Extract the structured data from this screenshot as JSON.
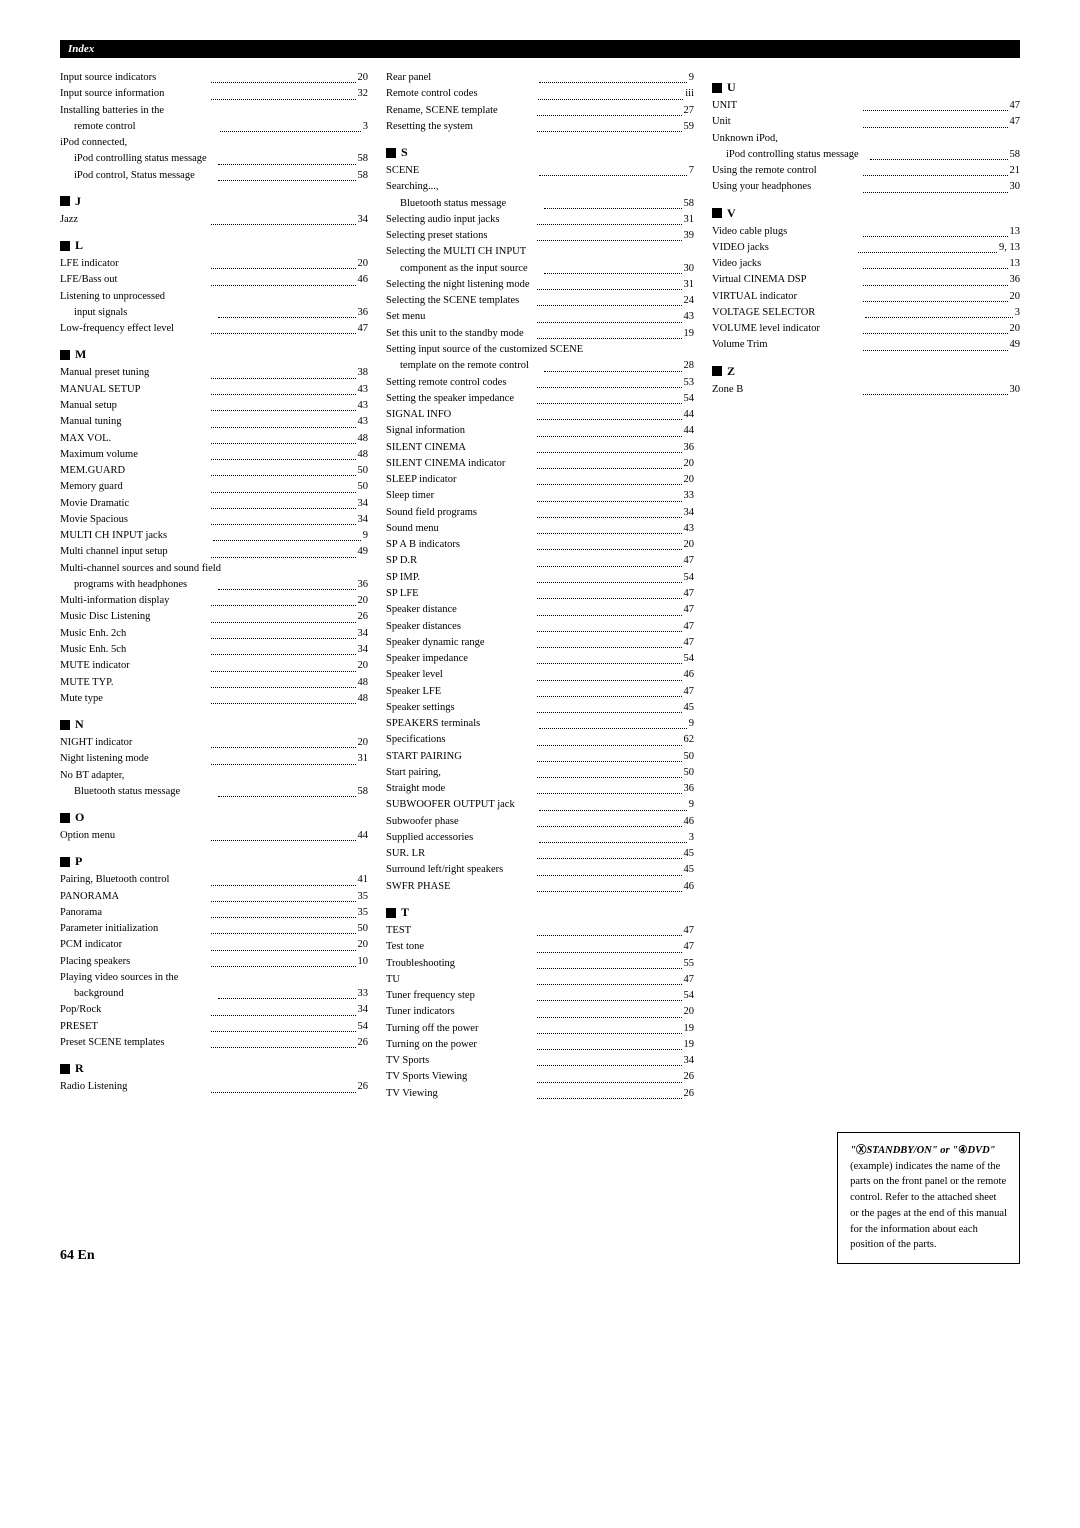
{
  "header": {
    "label": "Index"
  },
  "pageNumber": "64 En",
  "columns": [
    {
      "id": "col1",
      "sections": [
        {
          "type": "entries",
          "items": [
            {
              "text": "Input source indicators",
              "page": "20"
            },
            {
              "text": "Input source information",
              "page": "32"
            },
            {
              "text": "Installing batteries in the",
              "page": ""
            },
            {
              "text": "remote control",
              "page": "3",
              "indent": 1
            },
            {
              "text": "iPod connected,",
              "page": ""
            },
            {
              "text": "iPod controlling status message",
              "page": "58",
              "indent": 1
            },
            {
              "text": "iPod control, Status message",
              "page": "58",
              "indent": 1
            }
          ]
        },
        {
          "type": "section",
          "letter": "J",
          "items": [
            {
              "text": "Jazz",
              "page": "34"
            }
          ]
        },
        {
          "type": "section",
          "letter": "L",
          "items": [
            {
              "text": "LFE indicator",
              "page": "20"
            },
            {
              "text": "LFE/Bass out",
              "page": "46"
            },
            {
              "text": "Listening to unprocessed",
              "page": ""
            },
            {
              "text": "input signals",
              "page": "36",
              "indent": 1
            },
            {
              "text": "Low-frequency effect level",
              "page": "47"
            }
          ]
        },
        {
          "type": "section",
          "letter": "M",
          "items": [
            {
              "text": "Manual preset tuning",
              "page": "38"
            },
            {
              "text": "MANUAL SETUP",
              "page": "43"
            },
            {
              "text": "Manual setup",
              "page": "43"
            },
            {
              "text": "Manual tuning",
              "page": "43"
            },
            {
              "text": "MAX VOL.",
              "page": "48"
            },
            {
              "text": "Maximum volume",
              "page": "48"
            },
            {
              "text": "MEM.GUARD",
              "page": "50"
            },
            {
              "text": "Memory guard",
              "page": "50"
            },
            {
              "text": "Movie Dramatic",
              "page": "34"
            },
            {
              "text": "Movie Spacious",
              "page": "34"
            },
            {
              "text": "MULTI CH INPUT jacks",
              "page": "9"
            },
            {
              "text": "Multi channel input setup",
              "page": "49"
            },
            {
              "text": "Multi-channel sources and sound field",
              "page": ""
            },
            {
              "text": "programs with headphones",
              "page": "36",
              "indent": 1
            },
            {
              "text": "Multi-information display",
              "page": "20"
            },
            {
              "text": "Music Disc Listening",
              "page": "26"
            },
            {
              "text": "Music Enh. 2ch",
              "page": "34"
            },
            {
              "text": "Music Enh. 5ch",
              "page": "34"
            },
            {
              "text": "MUTE indicator",
              "page": "20"
            },
            {
              "text": "MUTE TYP.",
              "page": "48"
            },
            {
              "text": "Mute type",
              "page": "48"
            }
          ]
        },
        {
          "type": "section",
          "letter": "N",
          "items": [
            {
              "text": "NIGHT indicator",
              "page": "20"
            },
            {
              "text": "Night listening mode",
              "page": "31"
            },
            {
              "text": "No BT adapter,",
              "page": ""
            },
            {
              "text": "Bluetooth status message",
              "page": "58",
              "indent": 1
            }
          ]
        },
        {
          "type": "section",
          "letter": "O",
          "items": [
            {
              "text": "Option menu",
              "page": "44"
            }
          ]
        },
        {
          "type": "section",
          "letter": "P",
          "items": [
            {
              "text": "Pairing, Bluetooth control",
              "page": "41"
            },
            {
              "text": "PANORAMA",
              "page": "35"
            },
            {
              "text": "Panorama",
              "page": "35"
            },
            {
              "text": "Parameter initialization",
              "page": "50"
            },
            {
              "text": "PCM indicator",
              "page": "20"
            },
            {
              "text": "Placing speakers",
              "page": "10"
            },
            {
              "text": "Playing video sources in the",
              "page": ""
            },
            {
              "text": "background",
              "page": "33",
              "indent": 1
            },
            {
              "text": "Pop/Rock",
              "page": "34"
            },
            {
              "text": "PRESET",
              "page": "54"
            },
            {
              "text": "Preset SCENE templates",
              "page": "26"
            }
          ]
        },
        {
          "type": "section",
          "letter": "R",
          "items": [
            {
              "text": "Radio Listening",
              "page": "26"
            }
          ]
        }
      ]
    },
    {
      "id": "col2",
      "sections": [
        {
          "type": "entries",
          "items": [
            {
              "text": "Rear panel",
              "page": "9"
            },
            {
              "text": "Remote control codes",
              "page": "iii"
            },
            {
              "text": "Rename, SCENE template",
              "page": "27"
            },
            {
              "text": "Resetting the system",
              "page": "59"
            }
          ]
        },
        {
          "type": "section",
          "letter": "S",
          "items": [
            {
              "text": "SCENE",
              "page": "7"
            },
            {
              "text": "Searching...,",
              "page": ""
            },
            {
              "text": "Bluetooth status message",
              "page": "58",
              "indent": 1
            },
            {
              "text": "Selecting audio input jacks",
              "page": "31"
            },
            {
              "text": "Selecting preset stations",
              "page": "39"
            },
            {
              "text": "Selecting the MULTI CH INPUT",
              "page": ""
            },
            {
              "text": "component as the input source",
              "page": "30",
              "indent": 1
            },
            {
              "text": "Selecting the night listening mode",
              "page": "31"
            },
            {
              "text": "Selecting the SCENE templates",
              "page": "24"
            },
            {
              "text": "Set menu",
              "page": "43"
            },
            {
              "text": "Set this unit to the standby mode",
              "page": "19"
            },
            {
              "text": "Setting input source of the customized SCENE",
              "page": ""
            },
            {
              "text": "template on the remote control",
              "page": "28",
              "indent": 1
            },
            {
              "text": "Setting remote control codes",
              "page": "53"
            },
            {
              "text": "Setting the speaker impedance",
              "page": "54"
            },
            {
              "text": "SIGNAL INFO",
              "page": "44"
            },
            {
              "text": "Signal information",
              "page": "44"
            },
            {
              "text": "SILENT CINEMA",
              "page": "36"
            },
            {
              "text": "SILENT CINEMA indicator",
              "page": "20"
            },
            {
              "text": "SLEEP indicator",
              "page": "20"
            },
            {
              "text": "Sleep timer",
              "page": "33"
            },
            {
              "text": "Sound field programs",
              "page": "34"
            },
            {
              "text": "Sound menu",
              "page": "43"
            },
            {
              "text": "SP A B indicators",
              "page": "20"
            },
            {
              "text": "SP D.R",
              "page": "47"
            },
            {
              "text": "SP IMP.",
              "page": "54"
            },
            {
              "text": "SP LFE",
              "page": "47"
            },
            {
              "text": "Speaker distance",
              "page": "47"
            },
            {
              "text": "Speaker distances",
              "page": "47"
            },
            {
              "text": "Speaker dynamic range",
              "page": "47"
            },
            {
              "text": "Speaker impedance",
              "page": "54"
            },
            {
              "text": "Speaker level",
              "page": "46"
            },
            {
              "text": "Speaker LFE",
              "page": "47"
            },
            {
              "text": "Speaker settings",
              "page": "45"
            },
            {
              "text": "SPEAKERS terminals",
              "page": "9"
            },
            {
              "text": "Specifications",
              "page": "62"
            },
            {
              "text": "START PAIRING",
              "page": "50"
            },
            {
              "text": "Start pairing,",
              "page": "50"
            },
            {
              "text": "Straight mode",
              "page": "36"
            },
            {
              "text": "SUBWOOFER OUTPUT jack",
              "page": "9"
            },
            {
              "text": "Subwoofer phase",
              "page": "46"
            },
            {
              "text": "Supplied accessories",
              "page": "3"
            },
            {
              "text": "SUR. LR",
              "page": "45"
            },
            {
              "text": "Surround left/right speakers",
              "page": "45"
            },
            {
              "text": "SWFR PHASE",
              "page": "46"
            }
          ]
        },
        {
          "type": "section",
          "letter": "T",
          "items": [
            {
              "text": "TEST",
              "page": "47"
            },
            {
              "text": "Test tone",
              "page": "47"
            },
            {
              "text": "Troubleshooting",
              "page": "55"
            },
            {
              "text": "TU",
              "page": "47"
            },
            {
              "text": "Tuner frequency step",
              "page": "54"
            },
            {
              "text": "Tuner indicators",
              "page": "20"
            },
            {
              "text": "Turning off the power",
              "page": "19"
            },
            {
              "text": "Turning on the power",
              "page": "19"
            },
            {
              "text": "TV Sports",
              "page": "34"
            },
            {
              "text": "TV Sports Viewing",
              "page": "26"
            },
            {
              "text": "TV Viewing",
              "page": "26"
            }
          ]
        }
      ]
    },
    {
      "id": "col3",
      "sections": [
        {
          "type": "section",
          "letter": "U",
          "items": [
            {
              "text": "UNIT",
              "page": "47"
            },
            {
              "text": "Unit",
              "page": "47"
            },
            {
              "text": "Unknown iPod,",
              "page": ""
            },
            {
              "text": "iPod controlling status message",
              "page": "58",
              "indent": 1
            },
            {
              "text": "Using the remote control",
              "page": "21"
            },
            {
              "text": "Using your headphones",
              "page": "30"
            }
          ]
        },
        {
          "type": "section",
          "letter": "V",
          "items": [
            {
              "text": "Video cable plugs",
              "page": "13"
            },
            {
              "text": "VIDEO jacks",
              "page": "9, 13"
            },
            {
              "text": "Video jacks",
              "page": "13"
            },
            {
              "text": "Virtual CINEMA DSP",
              "page": "36"
            },
            {
              "text": "VIRTUAL indicator",
              "page": "20"
            },
            {
              "text": "VOLTAGE SELECTOR",
              "page": "3"
            },
            {
              "text": "VOLUME level indicator",
              "page": "20"
            },
            {
              "text": "Volume Trim",
              "page": "49"
            }
          ]
        },
        {
          "type": "section",
          "letter": "Z",
          "items": [
            {
              "text": "Zone B",
              "page": "30"
            }
          ]
        }
      ]
    }
  ],
  "noteBox": {
    "line1": "“ⓍSTANDBY/ON” or “④DVD”",
    "line2": "(example) indicates the name of the",
    "line3": "parts on the front panel or the remote",
    "line4": "control. Refer to the attached sheet",
    "line5": "or the pages at the end of this manual",
    "line6": "for the information about each",
    "line7": "position of the parts."
  }
}
